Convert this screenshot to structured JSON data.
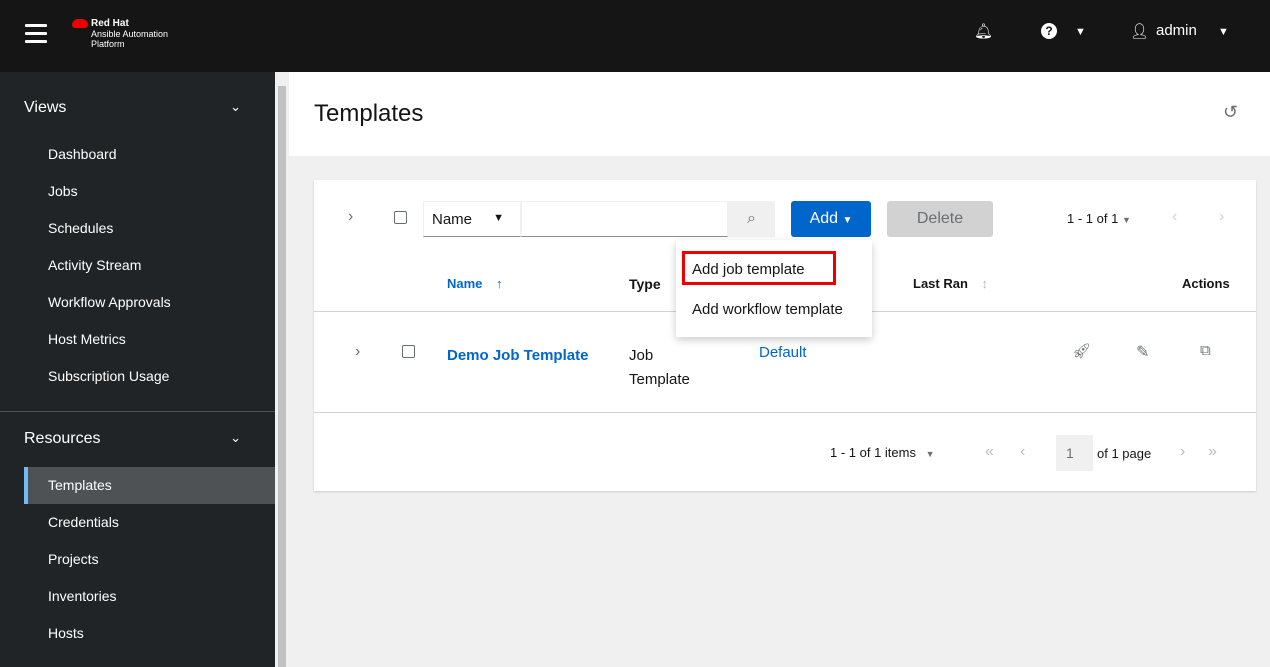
{
  "header": {
    "brand": "Red Hat",
    "product_line1": "Ansible Automation",
    "product_line2": "Platform",
    "user": "admin"
  },
  "sidebar": {
    "views_label": "Views",
    "views": [
      "Dashboard",
      "Jobs",
      "Schedules",
      "Activity Stream",
      "Workflow Approvals",
      "Host Metrics",
      "Subscription Usage"
    ],
    "resources_label": "Resources",
    "resources": [
      "Templates",
      "Credentials",
      "Projects",
      "Inventories",
      "Hosts"
    ],
    "active": "Templates"
  },
  "page": {
    "title": "Templates"
  },
  "toolbar": {
    "filter_field": "Name",
    "search_placeholder": "",
    "add_label": "Add",
    "delete_label": "Delete",
    "pagination": "1 - 1 of 1"
  },
  "add_menu": [
    "Add job template",
    "Add workflow template"
  ],
  "table": {
    "columns": {
      "name": "Name",
      "type": "Type",
      "last_ran": "Last Ran",
      "actions": "Actions"
    },
    "rows": [
      {
        "name": "Demo Job Template",
        "type": "Job Template",
        "inventory": "Default"
      }
    ]
  },
  "footer": {
    "items": "1 - 1 of 1 items",
    "page": "1",
    "of_pages": "of 1 page"
  }
}
